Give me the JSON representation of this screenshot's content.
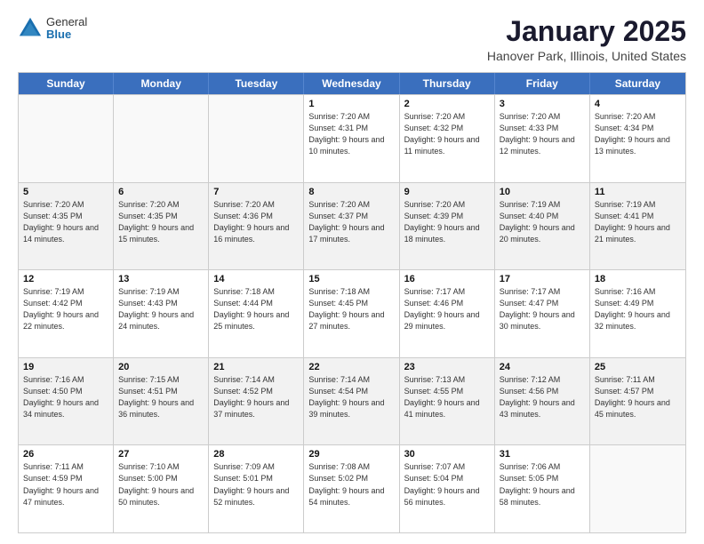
{
  "logo": {
    "general": "General",
    "blue": "Blue"
  },
  "title": "January 2025",
  "location": "Hanover Park, Illinois, United States",
  "days_of_week": [
    "Sunday",
    "Monday",
    "Tuesday",
    "Wednesday",
    "Thursday",
    "Friday",
    "Saturday"
  ],
  "weeks": [
    [
      {
        "day": "",
        "sunrise": "",
        "sunset": "",
        "daylight": ""
      },
      {
        "day": "",
        "sunrise": "",
        "sunset": "",
        "daylight": ""
      },
      {
        "day": "",
        "sunrise": "",
        "sunset": "",
        "daylight": ""
      },
      {
        "day": "1",
        "sunrise": "Sunrise: 7:20 AM",
        "sunset": "Sunset: 4:31 PM",
        "daylight": "Daylight: 9 hours and 10 minutes."
      },
      {
        "day": "2",
        "sunrise": "Sunrise: 7:20 AM",
        "sunset": "Sunset: 4:32 PM",
        "daylight": "Daylight: 9 hours and 11 minutes."
      },
      {
        "day": "3",
        "sunrise": "Sunrise: 7:20 AM",
        "sunset": "Sunset: 4:33 PM",
        "daylight": "Daylight: 9 hours and 12 minutes."
      },
      {
        "day": "4",
        "sunrise": "Sunrise: 7:20 AM",
        "sunset": "Sunset: 4:34 PM",
        "daylight": "Daylight: 9 hours and 13 minutes."
      }
    ],
    [
      {
        "day": "5",
        "sunrise": "Sunrise: 7:20 AM",
        "sunset": "Sunset: 4:35 PM",
        "daylight": "Daylight: 9 hours and 14 minutes."
      },
      {
        "day": "6",
        "sunrise": "Sunrise: 7:20 AM",
        "sunset": "Sunset: 4:35 PM",
        "daylight": "Daylight: 9 hours and 15 minutes."
      },
      {
        "day": "7",
        "sunrise": "Sunrise: 7:20 AM",
        "sunset": "Sunset: 4:36 PM",
        "daylight": "Daylight: 9 hours and 16 minutes."
      },
      {
        "day": "8",
        "sunrise": "Sunrise: 7:20 AM",
        "sunset": "Sunset: 4:37 PM",
        "daylight": "Daylight: 9 hours and 17 minutes."
      },
      {
        "day": "9",
        "sunrise": "Sunrise: 7:20 AM",
        "sunset": "Sunset: 4:39 PM",
        "daylight": "Daylight: 9 hours and 18 minutes."
      },
      {
        "day": "10",
        "sunrise": "Sunrise: 7:19 AM",
        "sunset": "Sunset: 4:40 PM",
        "daylight": "Daylight: 9 hours and 20 minutes."
      },
      {
        "day": "11",
        "sunrise": "Sunrise: 7:19 AM",
        "sunset": "Sunset: 4:41 PM",
        "daylight": "Daylight: 9 hours and 21 minutes."
      }
    ],
    [
      {
        "day": "12",
        "sunrise": "Sunrise: 7:19 AM",
        "sunset": "Sunset: 4:42 PM",
        "daylight": "Daylight: 9 hours and 22 minutes."
      },
      {
        "day": "13",
        "sunrise": "Sunrise: 7:19 AM",
        "sunset": "Sunset: 4:43 PM",
        "daylight": "Daylight: 9 hours and 24 minutes."
      },
      {
        "day": "14",
        "sunrise": "Sunrise: 7:18 AM",
        "sunset": "Sunset: 4:44 PM",
        "daylight": "Daylight: 9 hours and 25 minutes."
      },
      {
        "day": "15",
        "sunrise": "Sunrise: 7:18 AM",
        "sunset": "Sunset: 4:45 PM",
        "daylight": "Daylight: 9 hours and 27 minutes."
      },
      {
        "day": "16",
        "sunrise": "Sunrise: 7:17 AM",
        "sunset": "Sunset: 4:46 PM",
        "daylight": "Daylight: 9 hours and 29 minutes."
      },
      {
        "day": "17",
        "sunrise": "Sunrise: 7:17 AM",
        "sunset": "Sunset: 4:47 PM",
        "daylight": "Daylight: 9 hours and 30 minutes."
      },
      {
        "day": "18",
        "sunrise": "Sunrise: 7:16 AM",
        "sunset": "Sunset: 4:49 PM",
        "daylight": "Daylight: 9 hours and 32 minutes."
      }
    ],
    [
      {
        "day": "19",
        "sunrise": "Sunrise: 7:16 AM",
        "sunset": "Sunset: 4:50 PM",
        "daylight": "Daylight: 9 hours and 34 minutes."
      },
      {
        "day": "20",
        "sunrise": "Sunrise: 7:15 AM",
        "sunset": "Sunset: 4:51 PM",
        "daylight": "Daylight: 9 hours and 36 minutes."
      },
      {
        "day": "21",
        "sunrise": "Sunrise: 7:14 AM",
        "sunset": "Sunset: 4:52 PM",
        "daylight": "Daylight: 9 hours and 37 minutes."
      },
      {
        "day": "22",
        "sunrise": "Sunrise: 7:14 AM",
        "sunset": "Sunset: 4:54 PM",
        "daylight": "Daylight: 9 hours and 39 minutes."
      },
      {
        "day": "23",
        "sunrise": "Sunrise: 7:13 AM",
        "sunset": "Sunset: 4:55 PM",
        "daylight": "Daylight: 9 hours and 41 minutes."
      },
      {
        "day": "24",
        "sunrise": "Sunrise: 7:12 AM",
        "sunset": "Sunset: 4:56 PM",
        "daylight": "Daylight: 9 hours and 43 minutes."
      },
      {
        "day": "25",
        "sunrise": "Sunrise: 7:11 AM",
        "sunset": "Sunset: 4:57 PM",
        "daylight": "Daylight: 9 hours and 45 minutes."
      }
    ],
    [
      {
        "day": "26",
        "sunrise": "Sunrise: 7:11 AM",
        "sunset": "Sunset: 4:59 PM",
        "daylight": "Daylight: 9 hours and 47 minutes."
      },
      {
        "day": "27",
        "sunrise": "Sunrise: 7:10 AM",
        "sunset": "Sunset: 5:00 PM",
        "daylight": "Daylight: 9 hours and 50 minutes."
      },
      {
        "day": "28",
        "sunrise": "Sunrise: 7:09 AM",
        "sunset": "Sunset: 5:01 PM",
        "daylight": "Daylight: 9 hours and 52 minutes."
      },
      {
        "day": "29",
        "sunrise": "Sunrise: 7:08 AM",
        "sunset": "Sunset: 5:02 PM",
        "daylight": "Daylight: 9 hours and 54 minutes."
      },
      {
        "day": "30",
        "sunrise": "Sunrise: 7:07 AM",
        "sunset": "Sunset: 5:04 PM",
        "daylight": "Daylight: 9 hours and 56 minutes."
      },
      {
        "day": "31",
        "sunrise": "Sunrise: 7:06 AM",
        "sunset": "Sunset: 5:05 PM",
        "daylight": "Daylight: 9 hours and 58 minutes."
      },
      {
        "day": "",
        "sunrise": "",
        "sunset": "",
        "daylight": ""
      }
    ]
  ]
}
